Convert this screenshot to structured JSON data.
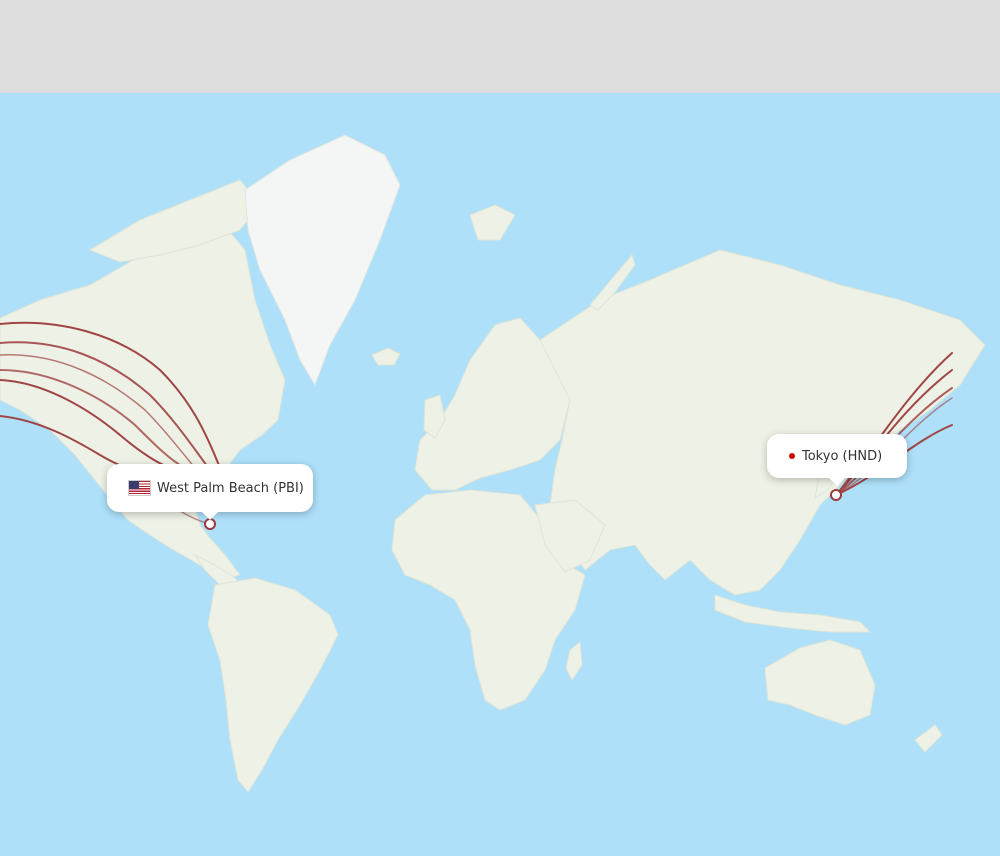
{
  "map": {
    "origin": {
      "code": "PBI",
      "city": "West Palm Beach",
      "label": "West Palm Beach (PBI)",
      "flag_icon": "us-flag-icon"
    },
    "destination": {
      "code": "HND",
      "city": "Tokyo",
      "label": "Tokyo (HND)",
      "marker_icon": "red-dot-icon"
    },
    "colors": {
      "water": "#aee0fa",
      "land": "#eef2e6",
      "route": "#a04545",
      "top_band": "#dedede"
    }
  }
}
